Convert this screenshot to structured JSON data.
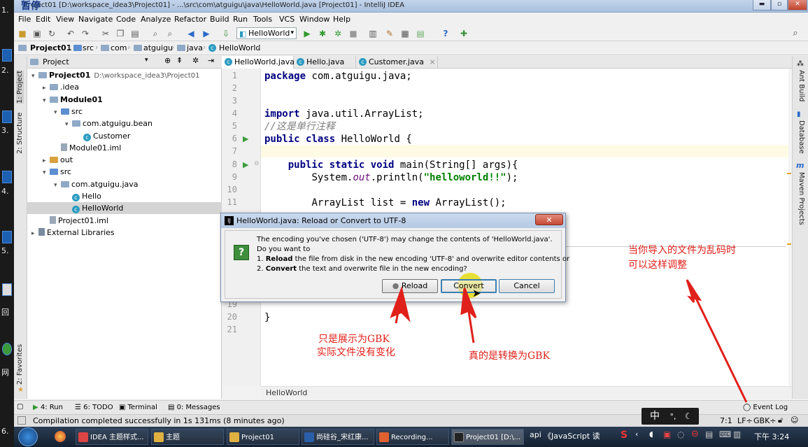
{
  "desktop": {
    "left_labels": [
      "1.",
      "2.",
      "3.",
      "4.",
      "5.",
      "回",
      "网",
      "6."
    ],
    "top_left_overlay": "暂停"
  },
  "window": {
    "title": "Project01 [D:\\workspace_idea3\\Project01] - ...\\src\\com\\atguigu\\java\\HelloWorld.java [Project01] - IntelliJ IDEA",
    "minimize": "▬",
    "maximize": "▫",
    "close": "✕"
  },
  "menu": [
    "File",
    "Edit",
    "View",
    "Navigate",
    "Code",
    "Analyze",
    "Refactor",
    "Build",
    "Run",
    "Tools",
    "VCS",
    "Window",
    "Help"
  ],
  "toolbar": {
    "run_config": "HelloWorld"
  },
  "breadcrumb": [
    "Project01",
    "src",
    "com",
    "atguigu",
    "java",
    "HelloWorld"
  ],
  "left_tool_strip": [
    "1: Project",
    "2: Structure",
    "2: Favorites"
  ],
  "right_tool_strip": [
    "Ant Build",
    "Database",
    "Maven Projects"
  ],
  "project_panel": {
    "header": "Project",
    "tree": [
      {
        "label": "Project01",
        "path": "D:\\workspace_idea3\\Project01",
        "indent": 0,
        "arrow": "▾",
        "icon": "folder",
        "bold": true
      },
      {
        "label": ".idea",
        "indent": 1,
        "arrow": "▸",
        "icon": "folder"
      },
      {
        "label": "Module01",
        "indent": 1,
        "arrow": "▾",
        "icon": "folder",
        "bold": true
      },
      {
        "label": "src",
        "indent": 2,
        "arrow": "▾",
        "icon": "folder-blue"
      },
      {
        "label": "com.atguigu.bean",
        "indent": 3,
        "arrow": "▾",
        "icon": "folder"
      },
      {
        "label": "Customer",
        "indent": 4,
        "arrow": "",
        "icon": "class"
      },
      {
        "label": "Module01.iml",
        "indent": 2,
        "arrow": "",
        "icon": "file"
      },
      {
        "label": "out",
        "indent": 1,
        "arrow": "▸",
        "icon": "folder-orange"
      },
      {
        "label": "src",
        "indent": 1,
        "arrow": "▾",
        "icon": "folder-blue"
      },
      {
        "label": "com.atguigu.java",
        "indent": 2,
        "arrow": "▾",
        "icon": "folder"
      },
      {
        "label": "Hello",
        "indent": 3,
        "arrow": "",
        "icon": "class"
      },
      {
        "label": "HelloWorld",
        "indent": 3,
        "arrow": "",
        "icon": "class",
        "selected": true
      },
      {
        "label": "Project01.iml",
        "indent": 1,
        "arrow": "",
        "icon": "file"
      },
      {
        "label": "External Libraries",
        "indent": 0,
        "arrow": "▸",
        "icon": "lib"
      }
    ]
  },
  "editor": {
    "tabs": [
      {
        "label": "HelloWorld.java",
        "active": true
      },
      {
        "label": "Hello.java",
        "active": false
      },
      {
        "label": "Customer.java",
        "active": false
      }
    ],
    "line_numbers": [
      "1",
      "2",
      "3",
      "4",
      "5",
      "6",
      "7",
      "8",
      "9",
      "10",
      "11",
      "19",
      "20",
      "21"
    ],
    "code": {
      "l1_kw": "package",
      "l1_rest": " com.atguigu.java;",
      "l4_kw": "import",
      "l4_rest": " java.util.ArrayList;",
      "l5_comment": "//这是单行注释",
      "l6_kw1": "public",
      "l6_kw2": "class",
      "l6_rest": " HelloWorld {",
      "l8_kw1": "public",
      "l8_kw2": "static",
      "l8_kw3": "void",
      "l8_rest": " main(String[] args){",
      "l9_a": "System.",
      "l9_field": "out",
      "l9_b": ".println(",
      "l9_str": "\"helloworld!!\"",
      "l9_c": ");",
      "l11_a": "ArrayList list = ",
      "l11_kw": "new",
      "l11_b": " ArrayList();",
      "l20": "}"
    },
    "footer": "HelloWorld"
  },
  "dialog": {
    "title": "HelloWorld.java: Reload or Convert to UTF-8",
    "close": "✕",
    "line1": "The encoding you've chosen ('UTF-8') may change the contents of 'HelloWorld.java'.",
    "line2": "Do you want to",
    "line3_num": "1. ",
    "line3_bold": "Reload",
    "line3_rest": " the file from disk in the new encoding 'UTF-8' and overwrite editor contents or",
    "line4_num": "2. ",
    "line4_bold": "Convert",
    "line4_rest": " the text and overwrite file in the new encoding?",
    "buttons": {
      "reload": "Reload",
      "convert": "Convert",
      "cancel": "Cancel"
    }
  },
  "annotations": {
    "note_reload_1": "只是展示为GBK",
    "note_reload_2": "实际文件没有变化",
    "note_convert": "真的是转换为GBK",
    "note_tip_1": "当你导入的文件为乱码时",
    "note_tip_2": "可以这样调整",
    "color": "#e0201a"
  },
  "tool_tabs": [
    "4: Run",
    "6: TODO",
    "Terminal",
    "0: Messages"
  ],
  "event_log": "Event Log",
  "status": {
    "message": "Compilation completed successfully in 1s 131ms (8 minutes ago)",
    "position": "7:1",
    "line_sep": "LF÷",
    "encoding": "GBK÷"
  },
  "ime": {
    "label": "中",
    "extra": "°,"
  },
  "taskbar": {
    "items": [
      {
        "label": "IDEA 主题样式...",
        "color": "#d44"
      },
      {
        "label": "主题",
        "color": "#e0b040"
      },
      {
        "label": "Project01",
        "color": "#e0b040"
      },
      {
        "label": "尚硅谷_宋红康...",
        "color": "#2a5ea8"
      },
      {
        "label": "Recording...",
        "color": "#e06030"
      },
      {
        "label": "Project01 [D:\\...",
        "color": "#333",
        "active": true
      }
    ],
    "tray_text_1": "api",
    "tray_text_2": "《JavaScript 读",
    "clock": "下午 3:24"
  }
}
